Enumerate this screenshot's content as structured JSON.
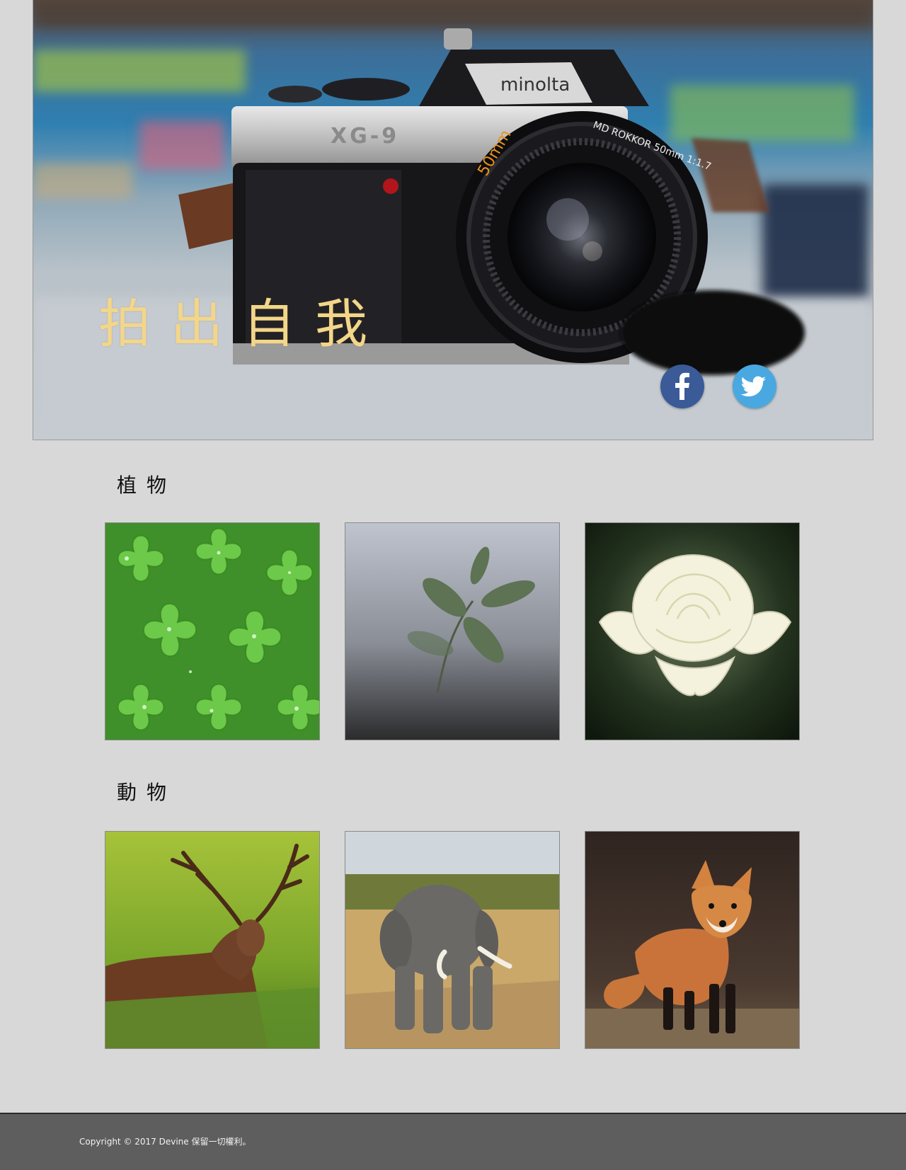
{
  "hero": {
    "title": "拍出自我",
    "camera_brand": "minolta",
    "camera_model": "XG-9",
    "lens_text": "MD ROKKOR 50mm 1:1.7"
  },
  "social": {
    "facebook_icon": "facebook-icon",
    "twitter_icon": "twitter-icon"
  },
  "sections": {
    "plants": {
      "title": "植物",
      "items": [
        "clover-photo",
        "leaf-sprig-photo",
        "white-rose-photo"
      ]
    },
    "animals": {
      "title": "動物",
      "items": [
        "deer-photo",
        "elephant-photo",
        "fox-photo"
      ]
    }
  },
  "footer": {
    "copyright": "Copyright © 2017 Devine 保留一切權利。"
  },
  "colors": {
    "page_bg": "#d8d8d8",
    "hero_title": "#f3d68a",
    "facebook": "#3a5a98",
    "twitter": "#4aa8e0",
    "footer_bg": "#5e5e5e"
  }
}
